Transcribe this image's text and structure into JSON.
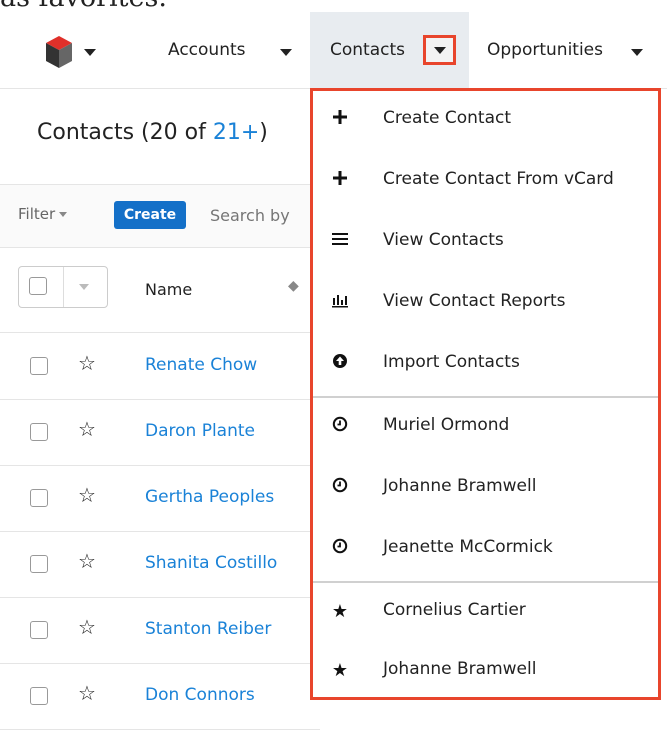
{
  "caption_fragment": "as favorites.",
  "nav": {
    "items": [
      {
        "label": "Accounts"
      },
      {
        "label": "Contacts"
      },
      {
        "label": "Opportunities"
      }
    ]
  },
  "list": {
    "title_prefix": "Contacts (20 of ",
    "title_count": "21+",
    "title_suffix": ")",
    "filter_label": "Filter",
    "create_label": "Create",
    "search_placeholder": "Search by",
    "column_name": "Name",
    "rows": [
      {
        "name": "Renate Chow"
      },
      {
        "name": "Daron Plante"
      },
      {
        "name": "Gertha Peoples"
      },
      {
        "name": "Shanita Costillo"
      },
      {
        "name": "Stanton Reiber"
      },
      {
        "name": "Don Connors"
      }
    ]
  },
  "dropdown": {
    "items": [
      {
        "label": "Create Contact",
        "icon": "plus-icon"
      },
      {
        "label": "Create Contact From vCard",
        "icon": "plus-icon"
      },
      {
        "label": "View Contacts",
        "icon": "list-icon"
      },
      {
        "label": "View Contact Reports",
        "icon": "bar-chart-icon"
      },
      {
        "label": "Import Contacts",
        "icon": "upload-icon"
      },
      {
        "label": "Muriel Ormond",
        "icon": "clock-icon"
      },
      {
        "label": "Johanne Bramwell",
        "icon": "clock-icon"
      },
      {
        "label": "Jeanette McCormick",
        "icon": "clock-icon"
      },
      {
        "label": "Cornelius Cartier",
        "icon": "star-icon"
      },
      {
        "label": "Johanne Bramwell",
        "icon": "star-icon"
      }
    ]
  },
  "colors": {
    "highlight": "#e8452c",
    "link": "#1a82d7",
    "create_button": "#1470c8"
  }
}
